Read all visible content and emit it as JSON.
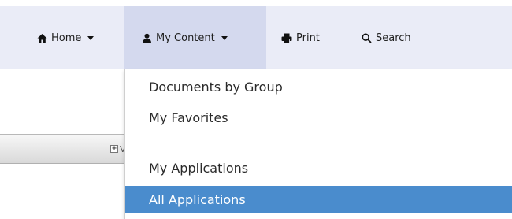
{
  "nav": {
    "home_label": "Home",
    "my_content_label": "My Content",
    "print_label": "Print",
    "search_label": "Search"
  },
  "dropdown": {
    "items": [
      {
        "label": "Documents by Group"
      },
      {
        "label": "My Favorites"
      },
      {
        "label": "My Applications"
      },
      {
        "label": "All Applications"
      }
    ],
    "highlight_color": "#4a8ccd"
  },
  "panel": {
    "expand_symbol": "+",
    "clipped_text": "V"
  },
  "icons": [
    "home-icon",
    "user-icon",
    "print-icon",
    "search-icon",
    "chevron-down-icon"
  ]
}
